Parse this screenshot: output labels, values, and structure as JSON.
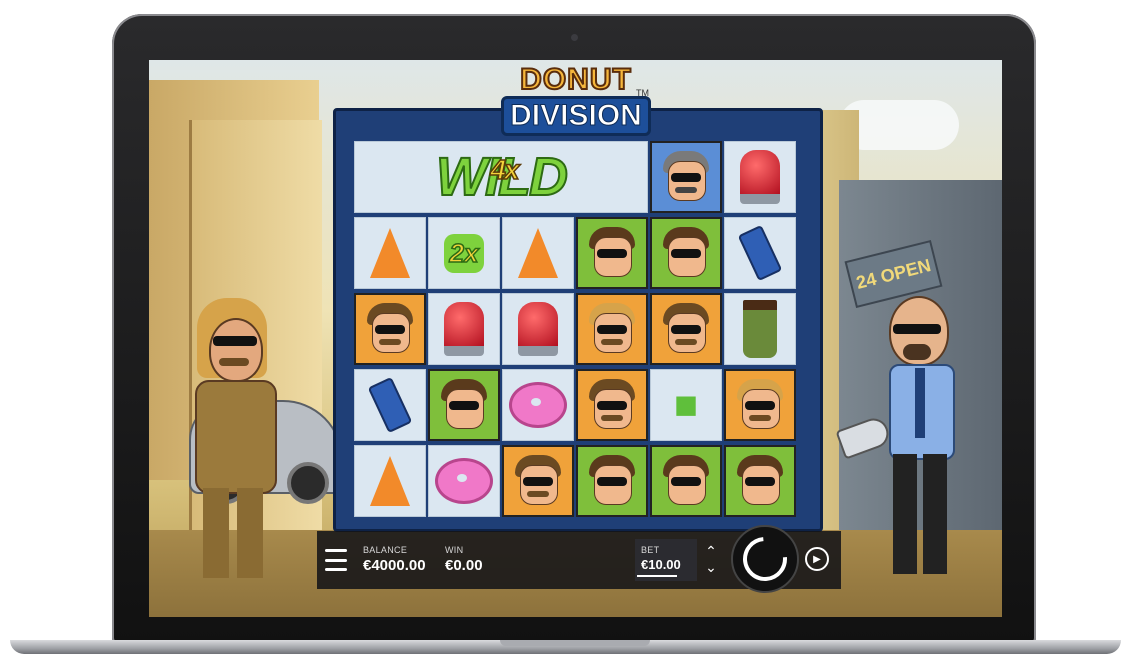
{
  "game": {
    "logo_line1": "DONUT",
    "logo_line2": "DIVISION",
    "logo_tm": "TM"
  },
  "scene": {
    "shop_sign": "24 OPEN"
  },
  "reels": {
    "wild_banner": {
      "text": "WILD",
      "multiplier": "4x"
    },
    "rows": [
      [
        "wild-banner",
        "wild-banner",
        "wild-banner",
        "wild-banner",
        "officer-sunglasses-blue",
        "red-siren"
      ],
      [
        "traffic-cone",
        "wild-2x",
        "traffic-cone",
        "officer-brown-hair-green",
        "officer-brown-hair-green",
        "walkie-talkie"
      ],
      [
        "officer-mustache-orange",
        "red-siren",
        "red-siren",
        "officer-blonde-orange",
        "officer-mustache-orange",
        "coffee-cup"
      ],
      [
        "walkie-talkie",
        "officer-brown-hair-green",
        "pink-donut",
        "officer-mustache-orange",
        "green-gun-wild",
        "officer-blonde-orange"
      ],
      [
        "traffic-cone",
        "pink-donut",
        "officer-mustache-orange",
        "officer-brown-hair-green",
        "officer-brown-hair-green",
        "officer-brown-hair-green"
      ]
    ],
    "multiplier_2x": "2x"
  },
  "controls": {
    "balance_label": "BALANCE",
    "balance_value": "€4000.00",
    "win_label": "WIN",
    "win_value": "€0.00",
    "bet_label": "BET",
    "bet_value": "€10.00"
  },
  "colors": {
    "board": "#1f3f77",
    "wild_green": "#7ed23d",
    "control_bar": "#141418"
  }
}
